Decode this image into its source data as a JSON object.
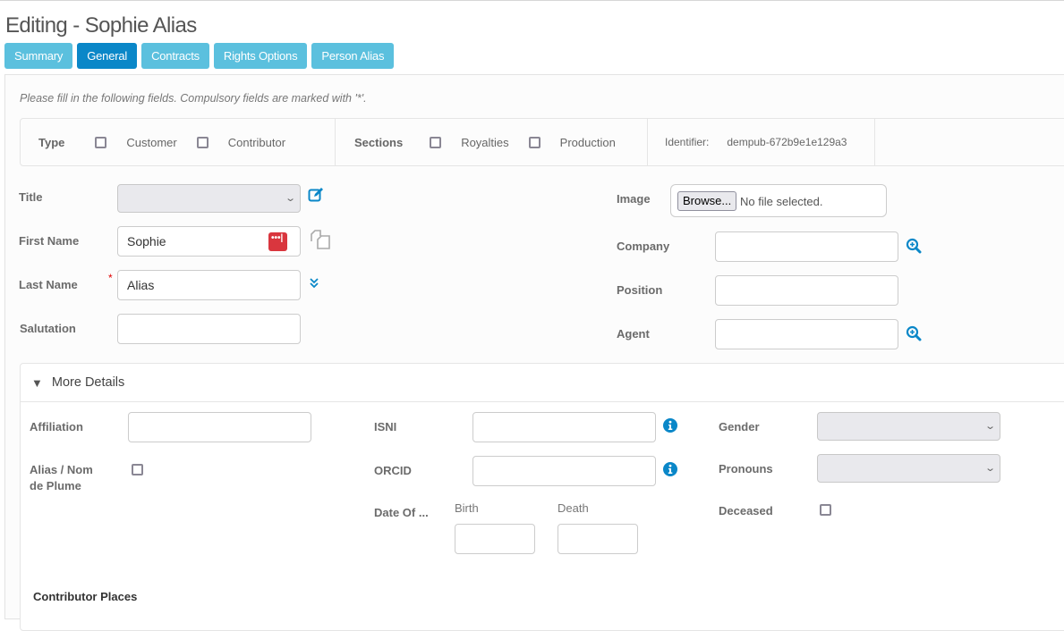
{
  "page": {
    "title": "Editing - Sophie Alias"
  },
  "tabs": [
    {
      "label": "Summary",
      "active": false
    },
    {
      "label": "General",
      "active": true
    },
    {
      "label": "Contracts",
      "active": false
    },
    {
      "label": "Rights Options",
      "active": false
    },
    {
      "label": "Person Alias",
      "active": false
    }
  ],
  "form": {
    "hint": "Please fill in the following fields. Compulsory fields are marked with '*'.",
    "type_bar": {
      "type_label": "Type",
      "type_options": [
        {
          "label": "Customer",
          "checked": false
        },
        {
          "label": "Contributor",
          "checked": false
        }
      ],
      "sections_label": "Sections",
      "section_options": [
        {
          "label": "Royalties",
          "checked": false
        },
        {
          "label": "Production",
          "checked": false
        }
      ],
      "identifier_label": "Identifier:",
      "identifier_value": "dempub-672b9e1e129a3"
    },
    "left": {
      "title_label": "Title",
      "title_value": "",
      "first_name_label": "First Name",
      "first_name_value": "Sophie",
      "last_name_label": "Last Name",
      "last_name_required": "*",
      "last_name_value": "Alias",
      "salutation_label": "Salutation",
      "salutation_value": ""
    },
    "right": {
      "image_label": "Image",
      "browse_label": "Browse...",
      "file_status": "No file selected.",
      "company_label": "Company",
      "company_value": "",
      "position_label": "Position",
      "position_value": "",
      "agent_label": "Agent",
      "agent_value": ""
    },
    "more_details": {
      "header": "More Details",
      "expanded": true,
      "affiliation_label": "Affiliation",
      "affiliation_value": "",
      "alias_label_line1": "Alias / Nom",
      "alias_label_line2": "de Plume",
      "alias_checked": false,
      "isni_label": "ISNI",
      "isni_value": "",
      "orcid_label": "ORCID",
      "orcid_value": "",
      "date_of_label": "Date Of ...",
      "birth_label": "Birth",
      "birth_value": "",
      "death_label": "Death",
      "death_value": "",
      "gender_label": "Gender",
      "gender_value": "",
      "pronouns_label": "Pronouns",
      "pronouns_value": "",
      "deceased_label": "Deceased",
      "deceased_checked": false
    },
    "contributor_places_label": "Contributor Places"
  },
  "colors": {
    "tab": "#5bc0de",
    "tab_active": "#0a87c8",
    "icon_accent": "#0a87c8",
    "password_manager": "#d9363e",
    "required": "#e00000"
  }
}
